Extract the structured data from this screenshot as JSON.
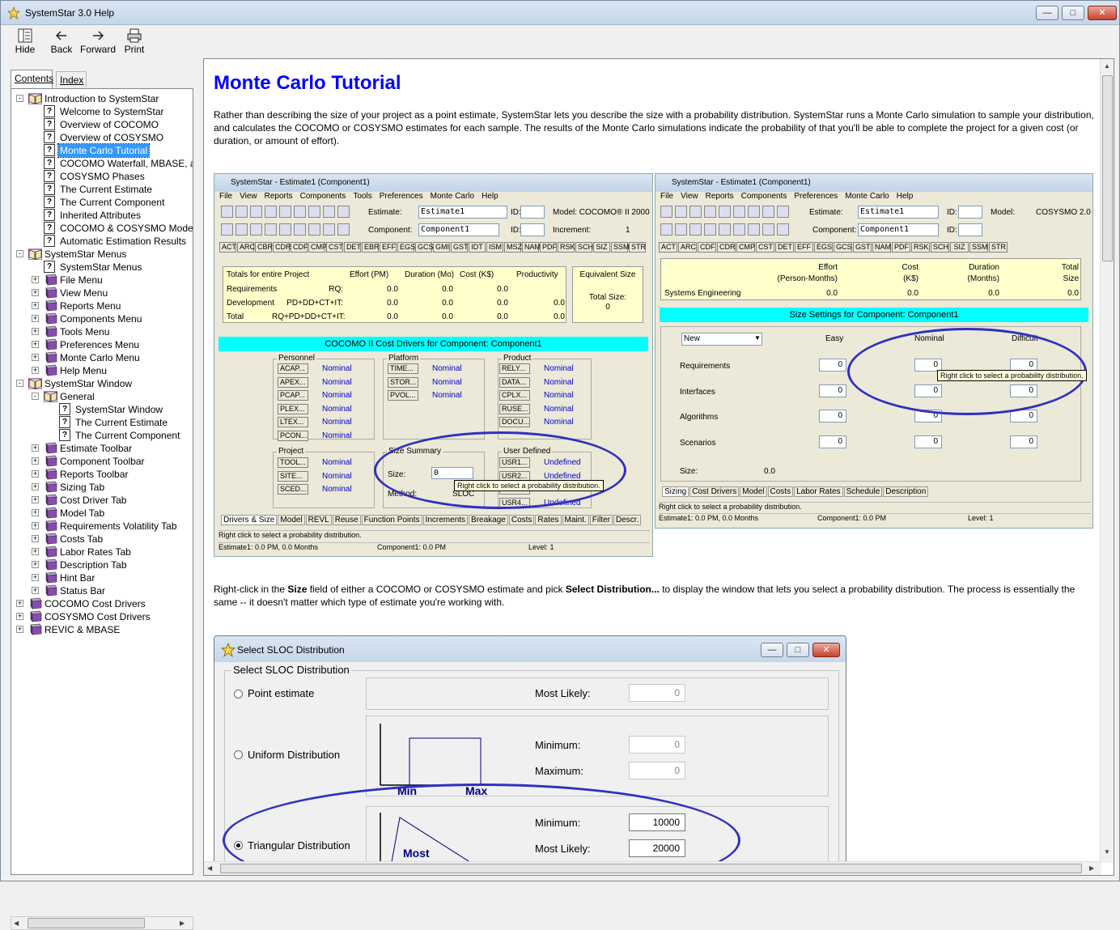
{
  "window": {
    "title": "SystemStar 3.0 Help"
  },
  "toolbar": {
    "hide": "Hide",
    "back": "Back",
    "forward": "Forward",
    "print": "Print"
  },
  "nav": {
    "tab_contents": "Contents",
    "tab_index": "Index"
  },
  "tree": [
    {
      "label": "Introduction to SystemStar",
      "type": "book-open",
      "depth": 0,
      "exp": "-"
    },
    {
      "label": "Welcome to SystemStar",
      "type": "page",
      "depth": 1
    },
    {
      "label": "Overview of COCOMO",
      "type": "page",
      "depth": 1
    },
    {
      "label": "Overview of COSYSMO",
      "type": "page",
      "depth": 1
    },
    {
      "label": "Monte Carlo Tutorial",
      "type": "page",
      "depth": 1,
      "selected": true
    },
    {
      "label": "COCOMO Waterfall, MBASE, a",
      "type": "page",
      "depth": 1
    },
    {
      "label": "COSYSMO Phases",
      "type": "page",
      "depth": 1
    },
    {
      "label": "The Current Estimate",
      "type": "page",
      "depth": 1
    },
    {
      "label": "The Current Component",
      "type": "page",
      "depth": 1
    },
    {
      "label": "Inherited Attributes",
      "type": "page",
      "depth": 1
    },
    {
      "label": "COCOMO & COSYSMO Model",
      "type": "page",
      "depth": 1
    },
    {
      "label": "Automatic Estimation Results",
      "type": "page",
      "depth": 1
    },
    {
      "label": "SystemStar Menus",
      "type": "book-open",
      "depth": 0,
      "exp": "-"
    },
    {
      "label": "SystemStar Menus",
      "type": "page",
      "depth": 1
    },
    {
      "label": "File Menu",
      "type": "book",
      "depth": 1,
      "exp": "+"
    },
    {
      "label": "View Menu",
      "type": "book",
      "depth": 1,
      "exp": "+"
    },
    {
      "label": "Reports Menu",
      "type": "book",
      "depth": 1,
      "exp": "+"
    },
    {
      "label": "Components Menu",
      "type": "book",
      "depth": 1,
      "exp": "+"
    },
    {
      "label": "Tools Menu",
      "type": "book",
      "depth": 1,
      "exp": "+"
    },
    {
      "label": "Preferences Menu",
      "type": "book",
      "depth": 1,
      "exp": "+"
    },
    {
      "label": "Monte Carlo Menu",
      "type": "book",
      "depth": 1,
      "exp": "+"
    },
    {
      "label": "Help Menu",
      "type": "book",
      "depth": 1,
      "exp": "+"
    },
    {
      "label": "SystemStar Window",
      "type": "book-open",
      "depth": 0,
      "exp": "-"
    },
    {
      "label": "General",
      "type": "book-open",
      "depth": 1,
      "exp": "-"
    },
    {
      "label": "SystemStar Window",
      "type": "page",
      "depth": 2
    },
    {
      "label": "The Current Estimate",
      "type": "page",
      "depth": 2
    },
    {
      "label": "The Current Component",
      "type": "page",
      "depth": 2
    },
    {
      "label": "Estimate Toolbar",
      "type": "book",
      "depth": 1,
      "exp": "+"
    },
    {
      "label": "Component Toolbar",
      "type": "book",
      "depth": 1,
      "exp": "+"
    },
    {
      "label": "Reports Toolbar",
      "type": "book",
      "depth": 1,
      "exp": "+"
    },
    {
      "label": "Sizing Tab",
      "type": "book",
      "depth": 1,
      "exp": "+"
    },
    {
      "label": "Cost Driver Tab",
      "type": "book",
      "depth": 1,
      "exp": "+"
    },
    {
      "label": "Model Tab",
      "type": "book",
      "depth": 1,
      "exp": "+"
    },
    {
      "label": "Requirements Volatility Tab",
      "type": "book",
      "depth": 1,
      "exp": "+"
    },
    {
      "label": "Costs Tab",
      "type": "book",
      "depth": 1,
      "exp": "+"
    },
    {
      "label": "Labor Rates Tab",
      "type": "book",
      "depth": 1,
      "exp": "+"
    },
    {
      "label": "Description Tab",
      "type": "book",
      "depth": 1,
      "exp": "+"
    },
    {
      "label": "Hint Bar",
      "type": "book",
      "depth": 1,
      "exp": "+"
    },
    {
      "label": "Status Bar",
      "type": "book",
      "depth": 1,
      "exp": "+"
    },
    {
      "label": "COCOMO Cost Drivers",
      "type": "book",
      "depth": 0,
      "exp": "+"
    },
    {
      "label": "COSYSMO Cost Drivers",
      "type": "book",
      "depth": 0,
      "exp": "+"
    },
    {
      "label": "REVIC & MBASE",
      "type": "book",
      "depth": 0,
      "exp": "+"
    }
  ],
  "content": {
    "title": "Monte Carlo Tutorial",
    "para1": "Rather than describing the size of your project as a point estimate, SystemStar lets you describe the size with a probability distribution.  SystemStar runs a Monte Carlo simulation to sample your distribution, and calculates the COCOMO or COSYSMO estimates for each sample.  The results of the Monte Carlo simulations indicate the probability of that you'll be able to complete the project for a given cost (or duration, or amount of effort).",
    "para2_pre": "Right-click in the ",
    "para2_b1": "Size",
    "para2_mid": " field of either a COCOMO or COSYSMO estimate and pick ",
    "para2_b2": "Select Distribution...",
    "para2_post": " to display the window that lets you select a probability distribution.  The process is essentially the same -- it doesn't matter which type of estimate you're working with."
  },
  "shot1": {
    "title": "SystemStar - Estimate1 (Component1)",
    "menu": [
      "File",
      "View",
      "Reports",
      "Components",
      "Tools",
      "Preferences",
      "Monte Carlo",
      "Help"
    ],
    "estimate_label": "Estimate:",
    "estimate_value": "Estimate1",
    "id_label": "ID:",
    "model_label": "Model: COCOMO® II 2000",
    "component_label": "Component:",
    "component_value": "Component1",
    "increment_label": "Increment:",
    "increment_value": "1",
    "tabs": [
      "ACT",
      "ARC",
      "CBR",
      "CDR",
      "CDF",
      "CMP",
      "CST",
      "DET",
      "EBR",
      "EFF",
      "EGS",
      "GCS",
      "GMI",
      "GST",
      "IDT",
      "ISM",
      "MSZ",
      "NAM",
      "PDF",
      "RSK",
      "SCH",
      "SIZ",
      "SSM",
      "STR"
    ],
    "table_header": [
      "Totals for entire Project",
      "Effort (PM)",
      "Duration (Mo)",
      "Cost (K$)",
      "Productivity"
    ],
    "rows": [
      {
        "name": "Requirements",
        "formula": "RQ:",
        "effort": "0.0",
        "duration": "0.0",
        "cost": "0.0",
        "prod": ""
      },
      {
        "name": "Development",
        "formula": "PD+DD+CT+IT:",
        "effort": "0.0",
        "duration": "0.0",
        "cost": "0.0",
        "prod": "0.0"
      },
      {
        "name": "Total",
        "formula": "RQ+PD+DD+CT+IT:",
        "effort": "0.0",
        "duration": "0.0",
        "cost": "0.0",
        "prod": "0.0"
      }
    ],
    "equiv_size": "Equivalent Size",
    "total_size": "Total Size:",
    "total_size_value": "0",
    "drivers_title": "COCOMO II Cost Drivers for Component: Component1",
    "personnel": "Personnel",
    "platform": "Platform",
    "product": "Product",
    "project": "Project",
    "size_summary": "Size Summary",
    "user_defined": "User Defined",
    "personnel_items": [
      "ACAP...",
      "APEX...",
      "PCAP...",
      "PLEX...",
      "LTEX...",
      "PCON..."
    ],
    "platform_items": [
      "TIME...",
      "STOR...",
      "PVOL..."
    ],
    "product_items": [
      "RELY...",
      "DATA...",
      "CPLX...",
      "RUSE...",
      "DOCU..."
    ],
    "project_items": [
      "TOOL...",
      "SITE...",
      "SCED..."
    ],
    "user_items": [
      "USR1...",
      "USR2...",
      "USR3...",
      "USR4..."
    ],
    "nominal": "Nominal",
    "undefined": "Undefined",
    "size_label": "Size:",
    "size_value": "0",
    "method_label": "Method:",
    "method_value": "SLOC",
    "tooltip": "Right click to select a probability distribution.",
    "bottom_tabs": [
      "Drivers & Size",
      "Model",
      "REVL",
      "Reuse",
      "Function Points",
      "Increments",
      "Breakage",
      "Costs",
      "Rates",
      "Maint.",
      "Filter",
      "Descr."
    ],
    "hint": "Right click to select a probability distribution.",
    "status1": "Estimate1:  0.0 PM,  0.0 Months",
    "status2": "Component1:  0.0 PM",
    "status3": "Level:   1"
  },
  "shot2": {
    "title": "SystemStar - Estimate1 (Component1)",
    "menu": [
      "File",
      "View",
      "Reports",
      "Components",
      "Preferences",
      "Monte Carlo",
      "Help"
    ],
    "estimate_label": "Estimate:",
    "estimate_value": "Estimate1",
    "id_label": "ID:",
    "model_label": "Model:",
    "model_value": "COSYSMO 2.0",
    "component_label": "Component:",
    "component_value": "Component1",
    "tabs": [
      "ACT",
      "ARC",
      "CDF",
      "CDR",
      "CMP",
      "CST",
      "DET",
      "EFF",
      "EGS",
      "GCS",
      "GST",
      "NAM",
      "PDF",
      "RSK",
      "SCH",
      "SIZ",
      "SSM",
      "STR"
    ],
    "headers": [
      "Effort\n(Person-Months)",
      "Cost\n(K$)",
      "Duration\n(Months)",
      "Total\nSize"
    ],
    "row_name": "Systems Engineering",
    "row_vals": [
      "0.0",
      "0.0",
      "0.0",
      "0.0"
    ],
    "size_title": "Size Settings for Component: Component1",
    "dropdown": "New",
    "col_easy": "Easy",
    "col_nominal": "Nominal",
    "col_difficult": "Difficult",
    "row_labels": [
      "Requirements",
      "Interfaces",
      "Algorithms",
      "Scenarios"
    ],
    "zero": "0",
    "size_label": "Size:",
    "size_value": "0.0",
    "tooltip": "Right click to select a probability distribution.",
    "bottom_tabs": [
      "Sizing",
      "Cost Drivers",
      "Model",
      "Costs",
      "Labor Rates",
      "Schedule",
      "Description"
    ],
    "hint": "Right click to select a probability distribution.",
    "status1": "Estimate1:  0.0 PM,  0.0 Months",
    "status2": "Component1:  0.0 PM",
    "status3": "Level:   1"
  },
  "dialog": {
    "title": "Select SLOC Distribution",
    "group": "Select SLOC Distribution",
    "point": "Point estimate",
    "uniform": "Uniform Distribution",
    "triangular": "Triangular Distribution",
    "most_likely": "Most Likely:",
    "minimum": "Minimum:",
    "maximum": "Maximum:",
    "point_ml": "0",
    "uni_min": "0",
    "uni_max": "0",
    "tri_min": "10000",
    "tri_ml": "20000",
    "chart_min": "Min",
    "chart_max": "Max",
    "chart_most": "Most"
  },
  "colors": {
    "title_blue": "#0000ff",
    "selection": "#3399ff",
    "cyan": "#00ffff",
    "annotation": "#3030c0"
  }
}
